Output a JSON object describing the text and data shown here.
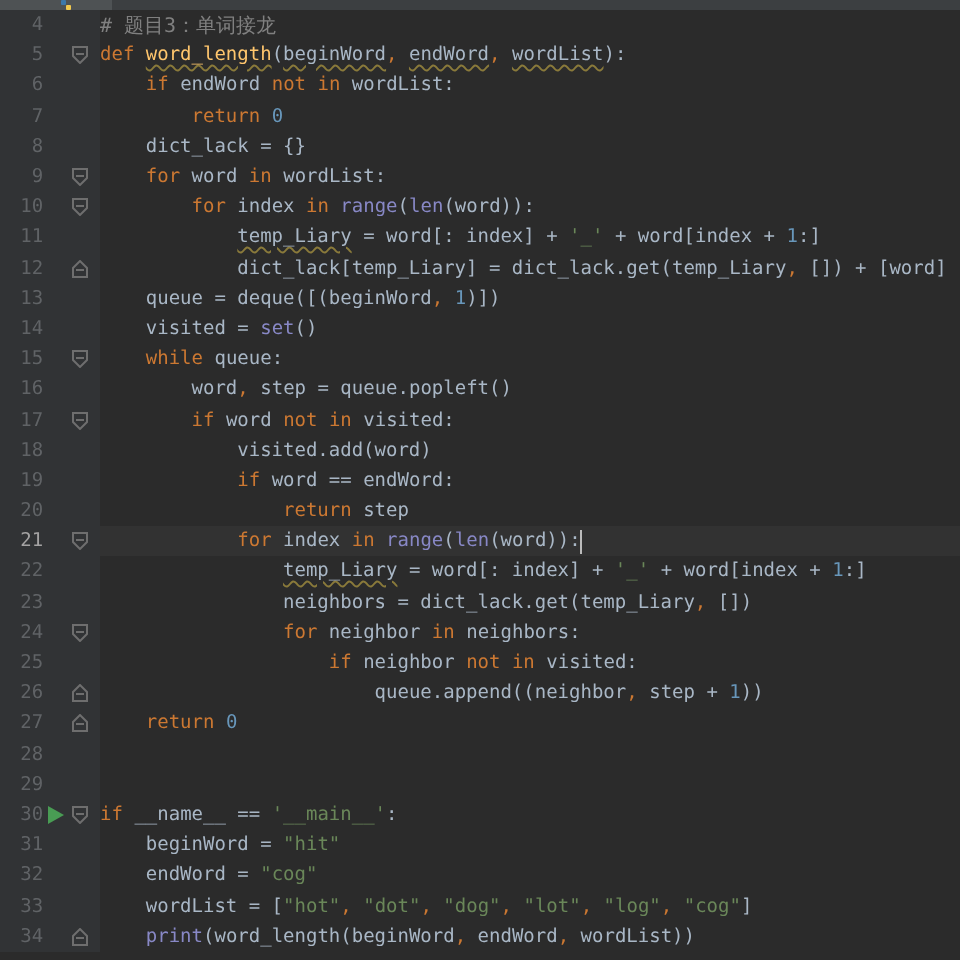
{
  "lines": [
    {
      "number": "4",
      "fold": false,
      "block_end": false,
      "current": false,
      "run": false,
      "tokens": [
        {
          "kind": "comment",
          "text": "# 题目3：单词接龙"
        }
      ]
    },
    {
      "number": "5",
      "fold": true,
      "block_end": false,
      "current": false,
      "run": false,
      "tokens": [
        {
          "kind": "kw",
          "text": "def "
        },
        {
          "kind": "fn-typo",
          "text": "word_length"
        },
        {
          "kind": "plain",
          "text": "("
        },
        {
          "kind": "typo",
          "text": "beginWord"
        },
        {
          "kind": "punct",
          "text": ", "
        },
        {
          "kind": "typo",
          "text": "endWord"
        },
        {
          "kind": "punct",
          "text": ", "
        },
        {
          "kind": "typo",
          "text": "wordList"
        },
        {
          "kind": "plain",
          "text": "):"
        }
      ]
    },
    {
      "number": "6",
      "fold": false,
      "block_end": false,
      "current": false,
      "run": false,
      "tokens": [
        {
          "kind": "kw",
          "text": "    if"
        },
        {
          "kind": "plain",
          "text": " endWord "
        },
        {
          "kind": "kw",
          "text": "not in"
        },
        {
          "kind": "plain",
          "text": " wordList:"
        }
      ]
    },
    {
      "number": "7",
      "fold": false,
      "block_end": false,
      "current": false,
      "run": false,
      "tokens": [
        {
          "kind": "kw",
          "text": "        return "
        },
        {
          "kind": "num",
          "text": "0"
        }
      ]
    },
    {
      "number": "8",
      "fold": false,
      "block_end": false,
      "current": false,
      "run": false,
      "tokens": [
        {
          "kind": "plain",
          "text": "    dict_lack = {}"
        }
      ]
    },
    {
      "number": "9",
      "fold": true,
      "block_end": false,
      "current": false,
      "run": false,
      "tokens": [
        {
          "kind": "kw",
          "text": "    for"
        },
        {
          "kind": "plain",
          "text": " word "
        },
        {
          "kind": "kw",
          "text": "in"
        },
        {
          "kind": "plain",
          "text": " wordList:"
        }
      ]
    },
    {
      "number": "10",
      "fold": true,
      "block_end": false,
      "current": false,
      "run": false,
      "tokens": [
        {
          "kind": "kw",
          "text": "        for"
        },
        {
          "kind": "plain",
          "text": " index "
        },
        {
          "kind": "kw",
          "text": "in "
        },
        {
          "kind": "builtin",
          "text": "range"
        },
        {
          "kind": "plain",
          "text": "("
        },
        {
          "kind": "builtin",
          "text": "len"
        },
        {
          "kind": "plain",
          "text": "(word)):"
        }
      ]
    },
    {
      "number": "11",
      "fold": false,
      "block_end": false,
      "current": false,
      "run": false,
      "tokens": [
        {
          "kind": "typo",
          "text": "            temp_Liary"
        },
        {
          "kind": "plain",
          "text": " = word[: index] + "
        },
        {
          "kind": "str",
          "text": "'_'"
        },
        {
          "kind": "plain",
          "text": " + word[index + "
        },
        {
          "kind": "num",
          "text": "1"
        },
        {
          "kind": "plain",
          "text": ":]"
        }
      ]
    },
    {
      "number": "12",
      "fold": false,
      "block_end": true,
      "current": false,
      "run": false,
      "tokens": [
        {
          "kind": "plain",
          "text": "            dict_lack[temp_Liary] = dict_lack.get(temp_Liary"
        },
        {
          "kind": "punct",
          "text": ","
        },
        {
          "kind": "plain",
          "text": " []) + [word]"
        }
      ]
    },
    {
      "number": "13",
      "fold": false,
      "block_end": false,
      "current": false,
      "run": false,
      "tokens": [
        {
          "kind": "plain",
          "text": "    queue = deque([(beginWord"
        },
        {
          "kind": "punct",
          "text": ", "
        },
        {
          "kind": "num",
          "text": "1"
        },
        {
          "kind": "plain",
          "text": ")])"
        }
      ]
    },
    {
      "number": "14",
      "fold": false,
      "block_end": false,
      "current": false,
      "run": false,
      "tokens": [
        {
          "kind": "plain",
          "text": "    visited = "
        },
        {
          "kind": "builtin",
          "text": "set"
        },
        {
          "kind": "plain",
          "text": "()"
        }
      ]
    },
    {
      "number": "15",
      "fold": true,
      "block_end": false,
      "current": false,
      "run": false,
      "tokens": [
        {
          "kind": "kw",
          "text": "    while"
        },
        {
          "kind": "plain",
          "text": " queue:"
        }
      ]
    },
    {
      "number": "16",
      "fold": false,
      "block_end": false,
      "current": false,
      "run": false,
      "tokens": [
        {
          "kind": "plain",
          "text": "        word"
        },
        {
          "kind": "punct",
          "text": ","
        },
        {
          "kind": "plain",
          "text": " step = queue.popleft()"
        }
      ]
    },
    {
      "number": "17",
      "fold": true,
      "block_end": false,
      "current": false,
      "run": false,
      "tokens": [
        {
          "kind": "kw",
          "text": "        if"
        },
        {
          "kind": "plain",
          "text": " word "
        },
        {
          "kind": "kw",
          "text": "not in"
        },
        {
          "kind": "plain",
          "text": " visited:"
        }
      ]
    },
    {
      "number": "18",
      "fold": false,
      "block_end": false,
      "current": false,
      "run": false,
      "tokens": [
        {
          "kind": "plain",
          "text": "            visited.add(word)"
        }
      ]
    },
    {
      "number": "19",
      "fold": false,
      "block_end": false,
      "current": false,
      "run": false,
      "tokens": [
        {
          "kind": "kw",
          "text": "            if"
        },
        {
          "kind": "plain",
          "text": " word == endWord:"
        }
      ]
    },
    {
      "number": "20",
      "fold": false,
      "block_end": false,
      "current": false,
      "run": false,
      "tokens": [
        {
          "kind": "kw",
          "text": "                return"
        },
        {
          "kind": "plain",
          "text": " step"
        }
      ]
    },
    {
      "number": "21",
      "fold": true,
      "block_end": false,
      "current": true,
      "run": false,
      "tokens": [
        {
          "kind": "kw",
          "text": "            for"
        },
        {
          "kind": "plain",
          "text": " index "
        },
        {
          "kind": "kw",
          "text": "in "
        },
        {
          "kind": "builtin",
          "text": "range"
        },
        {
          "kind": "plain",
          "text": "("
        },
        {
          "kind": "builtin",
          "text": "len"
        },
        {
          "kind": "plain",
          "text": "(word)):"
        }
      ]
    },
    {
      "number": "22",
      "fold": false,
      "block_end": false,
      "current": false,
      "run": false,
      "tokens": [
        {
          "kind": "typo",
          "text": "                temp_Liary"
        },
        {
          "kind": "plain",
          "text": " = word[: index] + "
        },
        {
          "kind": "str",
          "text": "'_'"
        },
        {
          "kind": "plain",
          "text": " + word[index + "
        },
        {
          "kind": "num",
          "text": "1"
        },
        {
          "kind": "plain",
          "text": ":]"
        }
      ]
    },
    {
      "number": "23",
      "fold": false,
      "block_end": false,
      "current": false,
      "run": false,
      "tokens": [
        {
          "kind": "plain",
          "text": "                neighbors = dict_lack.get(temp_Liary"
        },
        {
          "kind": "punct",
          "text": ","
        },
        {
          "kind": "plain",
          "text": " [])"
        }
      ]
    },
    {
      "number": "24",
      "fold": true,
      "block_end": false,
      "current": false,
      "run": false,
      "tokens": [
        {
          "kind": "kw",
          "text": "                for"
        },
        {
          "kind": "plain",
          "text": " neighbor "
        },
        {
          "kind": "kw",
          "text": "in"
        },
        {
          "kind": "plain",
          "text": " neighbors:"
        }
      ]
    },
    {
      "number": "25",
      "fold": false,
      "block_end": false,
      "current": false,
      "run": false,
      "tokens": [
        {
          "kind": "kw",
          "text": "                    if"
        },
        {
          "kind": "plain",
          "text": " neighbor "
        },
        {
          "kind": "kw",
          "text": "not in"
        },
        {
          "kind": "plain",
          "text": " visited:"
        }
      ]
    },
    {
      "number": "26",
      "fold": false,
      "block_end": true,
      "current": false,
      "run": false,
      "tokens": [
        {
          "kind": "plain",
          "text": "                        queue.append((neighbor"
        },
        {
          "kind": "punct",
          "text": ","
        },
        {
          "kind": "plain",
          "text": " step + "
        },
        {
          "kind": "num",
          "text": "1"
        },
        {
          "kind": "plain",
          "text": "))"
        }
      ]
    },
    {
      "number": "27",
      "fold": false,
      "block_end": true,
      "current": false,
      "run": false,
      "tokens": [
        {
          "kind": "kw",
          "text": "    return "
        },
        {
          "kind": "num",
          "text": "0"
        }
      ]
    },
    {
      "number": "28",
      "fold": false,
      "block_end": false,
      "current": false,
      "run": false
    },
    {
      "number": "29",
      "fold": false,
      "block_end": false,
      "current": false,
      "run": false
    },
    {
      "number": "30",
      "fold": true,
      "block_end": false,
      "current": false,
      "run": true,
      "tokens": [
        {
          "kind": "kw",
          "text": "if"
        },
        {
          "kind": "plain",
          "text": " __name__ == "
        },
        {
          "kind": "str",
          "text": "'__main__'"
        },
        {
          "kind": "plain",
          "text": ":"
        }
      ]
    },
    {
      "number": "31",
      "fold": false,
      "block_end": false,
      "current": false,
      "run": false,
      "tokens": [
        {
          "kind": "plain",
          "text": "    beginWord = "
        },
        {
          "kind": "str",
          "text": "\"hit\""
        }
      ]
    },
    {
      "number": "32",
      "fold": false,
      "block_end": false,
      "current": false,
      "run": false,
      "tokens": [
        {
          "kind": "plain",
          "text": "    endWord = "
        },
        {
          "kind": "str",
          "text": "\"cog\""
        }
      ]
    },
    {
      "number": "33",
      "fold": false,
      "block_end": false,
      "current": false,
      "run": false,
      "tokens": [
        {
          "kind": "plain",
          "text": "    wordList = ["
        },
        {
          "kind": "str",
          "text": "\"hot\""
        },
        {
          "kind": "punct",
          "text": ", "
        },
        {
          "kind": "str",
          "text": "\"dot\""
        },
        {
          "kind": "punct",
          "text": ", "
        },
        {
          "kind": "str",
          "text": "\"dog\""
        },
        {
          "kind": "punct",
          "text": ", "
        },
        {
          "kind": "str",
          "text": "\"lot\""
        },
        {
          "kind": "punct",
          "text": ", "
        },
        {
          "kind": "str",
          "text": "\"log\""
        },
        {
          "kind": "punct",
          "text": ", "
        },
        {
          "kind": "str",
          "text": "\"cog\""
        },
        {
          "kind": "plain",
          "text": "]"
        }
      ]
    },
    {
      "number": "34",
      "fold": false,
      "block_end": true,
      "current": false,
      "run": false,
      "tokens": [
        {
          "kind": "builtin",
          "text": "    print"
        },
        {
          "kind": "plain",
          "text": "(word_length(beginWord"
        },
        {
          "kind": "punct",
          "text": ", "
        },
        {
          "kind": "plain",
          "text": "endWord"
        },
        {
          "kind": "punct",
          "text": ", "
        },
        {
          "kind": "plain",
          "text": "wordList))"
        }
      ]
    }
  ]
}
